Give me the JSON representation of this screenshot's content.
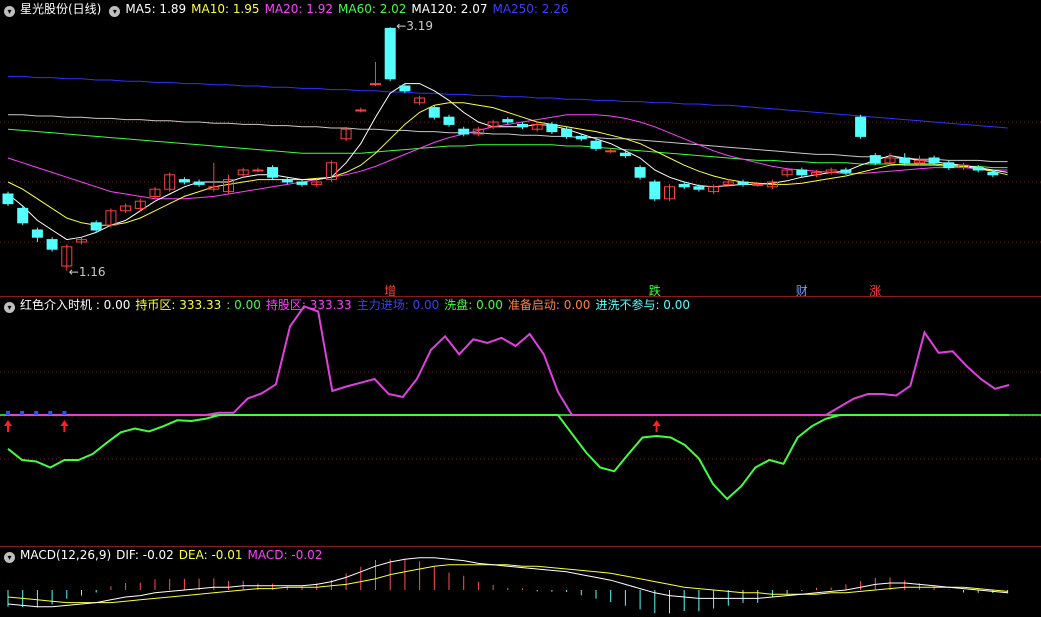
{
  "colors": {
    "up": "#ff4040",
    "down": "#54ffff",
    "ma5": "#ffffff",
    "ma10": "#ffff40",
    "ma20": "#ff40ff",
    "ma60": "#40ff40",
    "ma120": "#c8c8c8",
    "ma250": "#3030ff",
    "grid": "#7a1f1f"
  },
  "main": {
    "title": "星光股份(日线)",
    "ma": [
      {
        "label": "MA5: 1.89",
        "color": "#ffffff"
      },
      {
        "label": "MA10: 1.95",
        "color": "#ffff40"
      },
      {
        "label": "MA20: 1.92",
        "color": "#ff40ff"
      },
      {
        "label": "MA60: 2.02",
        "color": "#40ff40"
      },
      {
        "label": "MA120: 2.07",
        "color": "#ffffff"
      },
      {
        "label": "MA250: 2.26",
        "color": "#3c3cff"
      }
    ],
    "high_label": "3.19",
    "low_label": "1.16",
    "markers": [
      {
        "text": "增",
        "color": "#ff4040"
      },
      {
        "text": "跌",
        "color": "#40ff40"
      },
      {
        "text": "财",
        "color": "#6aa0ff"
      },
      {
        "text": "涨",
        "color": "#ff4040"
      }
    ]
  },
  "indicator": {
    "title": "红色介入时机 : 0.00",
    "items": [
      {
        "label": "持币区: 333.33",
        "color": "#ffff40"
      },
      {
        "label": ": 0.00",
        "color": "#40ff40"
      },
      {
        "label": "持股区: 333.33",
        "color": "#ff40ff"
      },
      {
        "label": "主力进场: 0.00",
        "color": "#3c3cff"
      },
      {
        "label": "洗盘: 0.00",
        "color": "#40ff40"
      },
      {
        "label": "准备启动: 0.00",
        "color": "#ff8040"
      },
      {
        "label": "进洗不参与: 0.00",
        "color": "#54ffff"
      }
    ]
  },
  "macd": {
    "title": "MACD(12,26,9)",
    "items": [
      {
        "label": "DIF: -0.02",
        "color": "#ffffff"
      },
      {
        "label": "DEA: -0.01",
        "color": "#ffff40"
      },
      {
        "label": "MACD: -0.02",
        "color": "#ff40ff"
      }
    ]
  },
  "candles": [
    [
      1.8,
      1.72,
      1.82,
      1.7
    ],
    [
      1.68,
      1.56,
      1.7,
      1.54
    ],
    [
      1.5,
      1.44,
      1.52,
      1.4
    ],
    [
      1.42,
      1.34,
      1.44,
      1.32
    ],
    [
      1.2,
      1.36,
      1.38,
      1.16
    ],
    [
      1.4,
      1.42,
      1.44,
      1.38
    ],
    [
      1.56,
      1.5,
      1.58,
      1.48
    ],
    [
      1.54,
      1.66,
      1.68,
      1.52
    ],
    [
      1.66,
      1.7,
      1.72,
      1.64
    ],
    [
      1.68,
      1.74,
      1.76,
      1.66
    ],
    [
      1.78,
      1.84,
      1.86,
      1.76
    ],
    [
      1.84,
      1.96,
      1.98,
      1.82
    ],
    [
      1.92,
      1.9,
      1.94,
      1.88
    ],
    [
      1.9,
      1.88,
      1.92,
      1.86
    ],
    [
      1.84,
      1.86,
      2.06,
      1.82
    ],
    [
      1.82,
      1.92,
      1.96,
      1.8
    ],
    [
      1.96,
      2.0,
      2.02,
      1.94
    ],
    [
      2.0,
      2.0,
      2.02,
      1.98
    ],
    [
      2.02,
      1.94,
      2.04,
      1.92
    ],
    [
      1.92,
      1.9,
      1.94,
      1.88
    ],
    [
      1.9,
      1.88,
      1.92,
      1.86
    ],
    [
      1.88,
      1.9,
      1.92,
      1.86
    ],
    [
      1.92,
      2.06,
      2.08,
      1.9
    ],
    [
      2.26,
      2.34,
      2.36,
      2.24
    ],
    [
      2.5,
      2.5,
      2.52,
      2.48
    ],
    [
      2.72,
      2.72,
      2.9,
      2.7
    ],
    [
      3.18,
      2.76,
      3.19,
      2.74
    ],
    [
      2.7,
      2.66,
      2.72,
      2.64
    ],
    [
      2.56,
      2.6,
      2.62,
      2.54
    ],
    [
      2.52,
      2.44,
      2.54,
      2.42
    ],
    [
      2.44,
      2.38,
      2.46,
      2.36
    ],
    [
      2.34,
      2.3,
      2.36,
      2.28
    ],
    [
      2.3,
      2.34,
      2.36,
      2.28
    ],
    [
      2.36,
      2.4,
      2.42,
      2.34
    ],
    [
      2.42,
      2.4,
      2.44,
      2.38
    ],
    [
      2.38,
      2.36,
      2.4,
      2.34
    ],
    [
      2.34,
      2.38,
      2.4,
      2.32
    ],
    [
      2.38,
      2.32,
      2.4,
      2.3
    ],
    [
      2.34,
      2.28,
      2.36,
      2.26
    ],
    [
      2.28,
      2.26,
      2.3,
      2.24
    ],
    [
      2.24,
      2.18,
      2.26,
      2.16
    ],
    [
      2.16,
      2.16,
      2.18,
      2.14
    ],
    [
      2.14,
      2.12,
      2.16,
      2.1
    ],
    [
      2.02,
      1.94,
      2.04,
      1.92
    ],
    [
      1.9,
      1.76,
      1.92,
      1.74
    ],
    [
      1.76,
      1.86,
      1.88,
      1.74
    ],
    [
      1.88,
      1.86,
      1.9,
      1.84
    ],
    [
      1.86,
      1.84,
      1.88,
      1.82
    ],
    [
      1.82,
      1.86,
      1.88,
      1.8
    ],
    [
      1.88,
      1.9,
      1.92,
      1.86
    ],
    [
      1.9,
      1.88,
      1.92,
      1.86
    ],
    [
      1.88,
      1.88,
      1.9,
      1.86
    ],
    [
      1.86,
      1.9,
      1.92,
      1.84
    ],
    [
      1.96,
      2.0,
      2.02,
      1.94
    ],
    [
      2.0,
      1.96,
      2.02,
      1.94
    ],
    [
      1.96,
      1.98,
      2.0,
      1.94
    ],
    [
      1.98,
      2.0,
      2.02,
      1.96
    ],
    [
      2.0,
      1.98,
      2.02,
      1.96
    ],
    [
      2.44,
      2.28,
      2.46,
      2.26
    ],
    [
      2.12,
      2.06,
      2.14,
      2.04
    ],
    [
      2.06,
      2.1,
      2.14,
      2.04
    ],
    [
      2.1,
      2.06,
      2.14,
      2.04
    ],
    [
      2.06,
      2.08,
      2.12,
      2.04
    ],
    [
      2.1,
      2.06,
      2.12,
      2.04
    ],
    [
      2.06,
      2.02,
      2.08,
      2.0
    ],
    [
      2.02,
      2.04,
      2.06,
      2.0
    ],
    [
      2.02,
      2.0,
      2.04,
      1.98
    ],
    [
      1.98,
      1.96,
      2.0,
      1.94
    ]
  ],
  "lines": {
    "ma5": [
      1.8,
      1.7,
      1.58,
      1.5,
      1.42,
      1.44,
      1.48,
      1.54,
      1.58,
      1.66,
      1.74,
      1.8,
      1.86,
      1.9,
      1.9,
      1.9,
      1.94,
      1.96,
      1.96,
      1.94,
      1.92,
      1.92,
      1.94,
      2.06,
      2.22,
      2.44,
      2.64,
      2.72,
      2.72,
      2.66,
      2.58,
      2.48,
      2.4,
      2.36,
      2.36,
      2.36,
      2.38,
      2.37,
      2.34,
      2.3,
      2.26,
      2.22,
      2.16,
      2.1,
      2.0,
      1.94,
      1.9,
      1.87,
      1.86,
      1.87,
      1.88,
      1.88,
      1.89,
      1.91,
      1.94,
      1.96,
      1.98,
      1.99,
      2.04,
      2.08,
      2.12,
      2.1,
      2.08,
      2.07,
      2.05,
      2.04,
      2.02,
      2.0,
      1.98
    ],
    "ma10": [
      1.9,
      1.84,
      1.76,
      1.68,
      1.6,
      1.56,
      1.54,
      1.54,
      1.56,
      1.6,
      1.66,
      1.72,
      1.78,
      1.82,
      1.86,
      1.88,
      1.9,
      1.92,
      1.92,
      1.92,
      1.92,
      1.93,
      1.94,
      1.98,
      2.04,
      2.14,
      2.26,
      2.38,
      2.48,
      2.54,
      2.56,
      2.56,
      2.54,
      2.52,
      2.48,
      2.44,
      2.4,
      2.38,
      2.36,
      2.34,
      2.32,
      2.29,
      2.26,
      2.22,
      2.16,
      2.1,
      2.04,
      1.99,
      1.95,
      1.92,
      1.9,
      1.89,
      1.88,
      1.88,
      1.89,
      1.91,
      1.93,
      1.95,
      1.98,
      2.01,
      2.04,
      2.05,
      2.05,
      2.05,
      2.04,
      2.03,
      2.01,
      1.99,
      1.96
    ],
    "ma20": [
      2.1,
      2.06,
      2.02,
      1.98,
      1.94,
      1.9,
      1.86,
      1.82,
      1.8,
      1.78,
      1.76,
      1.76,
      1.76,
      1.77,
      1.78,
      1.8,
      1.82,
      1.84,
      1.86,
      1.88,
      1.9,
      1.92,
      1.94,
      1.96,
      1.99,
      2.03,
      2.08,
      2.13,
      2.18,
      2.23,
      2.27,
      2.3,
      2.33,
      2.36,
      2.38,
      2.4,
      2.42,
      2.44,
      2.46,
      2.46,
      2.46,
      2.45,
      2.43,
      2.4,
      2.36,
      2.31,
      2.26,
      2.21,
      2.16,
      2.12,
      2.09,
      2.06,
      2.03,
      2.01,
      2.0,
      1.99,
      1.98,
      1.97,
      1.97,
      1.98,
      1.99,
      2.0,
      2.01,
      2.02,
      2.02,
      2.02,
      2.01,
      2.0,
      2.0
    ],
    "ma60": [
      2.34,
      2.33,
      2.32,
      2.31,
      2.3,
      2.29,
      2.28,
      2.27,
      2.26,
      2.25,
      2.24,
      2.23,
      2.22,
      2.21,
      2.2,
      2.19,
      2.18,
      2.17,
      2.16,
      2.15,
      2.14,
      2.14,
      2.14,
      2.14,
      2.14,
      2.15,
      2.16,
      2.17,
      2.18,
      2.19,
      2.2,
      2.2,
      2.21,
      2.21,
      2.21,
      2.21,
      2.21,
      2.21,
      2.2,
      2.2,
      2.19,
      2.18,
      2.17,
      2.16,
      2.15,
      2.14,
      2.13,
      2.12,
      2.11,
      2.1,
      2.09,
      2.08,
      2.08,
      2.07,
      2.07,
      2.06,
      2.06,
      2.06,
      2.05,
      2.05,
      2.05,
      2.04,
      2.04,
      2.04,
      2.03,
      2.03,
      2.03,
      2.02,
      2.02
    ],
    "ma120": [
      2.46,
      2.46,
      2.45,
      2.45,
      2.44,
      2.44,
      2.43,
      2.43,
      2.42,
      2.42,
      2.41,
      2.41,
      2.4,
      2.4,
      2.39,
      2.39,
      2.38,
      2.38,
      2.37,
      2.37,
      2.36,
      2.36,
      2.35,
      2.35,
      2.34,
      2.34,
      2.33,
      2.33,
      2.32,
      2.32,
      2.31,
      2.31,
      2.31,
      2.3,
      2.3,
      2.29,
      2.29,
      2.28,
      2.28,
      2.27,
      2.27,
      2.26,
      2.26,
      2.25,
      2.24,
      2.23,
      2.22,
      2.21,
      2.2,
      2.19,
      2.18,
      2.17,
      2.16,
      2.15,
      2.14,
      2.13,
      2.13,
      2.12,
      2.11,
      2.11,
      2.1,
      2.1,
      2.09,
      2.09,
      2.08,
      2.08,
      2.08,
      2.07,
      2.07
    ],
    "ma250": [
      2.78,
      2.78,
      2.77,
      2.77,
      2.76,
      2.76,
      2.75,
      2.75,
      2.74,
      2.74,
      2.73,
      2.73,
      2.72,
      2.72,
      2.71,
      2.71,
      2.7,
      2.7,
      2.69,
      2.69,
      2.68,
      2.68,
      2.67,
      2.67,
      2.66,
      2.66,
      2.65,
      2.65,
      2.64,
      2.64,
      2.63,
      2.63,
      2.62,
      2.62,
      2.61,
      2.61,
      2.6,
      2.6,
      2.59,
      2.59,
      2.58,
      2.58,
      2.57,
      2.57,
      2.56,
      2.56,
      2.55,
      2.55,
      2.54,
      2.54,
      2.53,
      2.52,
      2.51,
      2.5,
      2.49,
      2.48,
      2.47,
      2.46,
      2.45,
      2.44,
      2.43,
      2.42,
      2.41,
      2.4,
      2.39,
      2.38,
      2.37,
      2.36,
      2.35
    ]
  },
  "indicator_series": {
    "magenta": [
      0,
      0,
      0,
      0,
      0,
      0,
      0,
      0,
      0,
      0,
      0,
      0,
      0,
      0,
      0,
      3,
      3,
      22,
      29,
      41,
      118,
      145,
      138,
      32,
      38,
      43,
      48,
      28,
      24,
      48,
      87,
      105,
      81,
      101,
      96,
      103,
      92,
      108,
      81,
      31,
      0,
      0,
      0,
      0,
      0,
      0,
      0,
      0,
      0,
      0,
      0,
      0,
      0,
      0,
      0,
      0,
      0,
      0,
      0,
      11,
      22,
      28,
      28,
      26,
      39,
      110,
      83,
      85,
      65,
      48,
      35,
      40
    ],
    "green": [
      -45,
      -60,
      -62,
      -70,
      -60,
      -60,
      -52,
      -37,
      -23,
      -18,
      -22,
      -15,
      -7,
      -8,
      -5,
      0,
      0,
      0,
      0,
      0,
      0,
      0,
      0,
      0,
      0,
      0,
      0,
      0,
      0,
      0,
      0,
      0,
      0,
      0,
      0,
      0,
      0,
      0,
      0,
      0,
      -25,
      -50,
      -70,
      -75,
      -52,
      -30,
      -28,
      -30,
      -40,
      -58,
      -92,
      -112,
      -95,
      -70,
      -60,
      -65,
      -30,
      -15,
      -5,
      0,
      0,
      0,
      0,
      0,
      0,
      0,
      0,
      0,
      0,
      0,
      0,
      0
    ],
    "blue_bars": [
      0,
      1,
      2,
      3,
      4
    ],
    "arrows": [
      0,
      4,
      46
    ]
  },
  "macd_series": {
    "dif": [
      -0.1,
      -0.11,
      -0.12,
      -0.12,
      -0.11,
      -0.1,
      -0.09,
      -0.07,
      -0.05,
      -0.04,
      -0.02,
      -0.01,
      0.0,
      0.01,
      0.02,
      0.02,
      0.03,
      0.03,
      0.03,
      0.03,
      0.03,
      0.04,
      0.06,
      0.09,
      0.13,
      0.17,
      0.2,
      0.22,
      0.23,
      0.23,
      0.22,
      0.21,
      0.19,
      0.18,
      0.17,
      0.16,
      0.15,
      0.14,
      0.13,
      0.11,
      0.09,
      0.07,
      0.04,
      0.01,
      -0.02,
      -0.04,
      -0.05,
      -0.06,
      -0.06,
      -0.06,
      -0.06,
      -0.06,
      -0.05,
      -0.04,
      -0.03,
      -0.02,
      -0.01,
      0.0,
      0.02,
      0.04,
      0.05,
      0.05,
      0.04,
      0.03,
      0.02,
      0.01,
      0.0,
      -0.01,
      -0.02
    ],
    "dea": [
      -0.05,
      -0.06,
      -0.07,
      -0.08,
      -0.09,
      -0.09,
      -0.09,
      -0.09,
      -0.08,
      -0.07,
      -0.06,
      -0.05,
      -0.04,
      -0.03,
      -0.02,
      -0.01,
      0.0,
      0.01,
      0.01,
      0.02,
      0.02,
      0.02,
      0.03,
      0.04,
      0.06,
      0.08,
      0.11,
      0.13,
      0.15,
      0.17,
      0.18,
      0.18,
      0.18,
      0.18,
      0.18,
      0.17,
      0.17,
      0.16,
      0.15,
      0.14,
      0.13,
      0.12,
      0.1,
      0.08,
      0.06,
      0.04,
      0.02,
      0.01,
      0.0,
      -0.01,
      -0.02,
      -0.02,
      -0.03,
      -0.03,
      -0.03,
      -0.03,
      -0.02,
      -0.02,
      -0.01,
      0.0,
      0.01,
      0.02,
      0.02,
      0.02,
      0.02,
      0.02,
      0.01,
      0.0,
      -0.01
    ]
  }
}
